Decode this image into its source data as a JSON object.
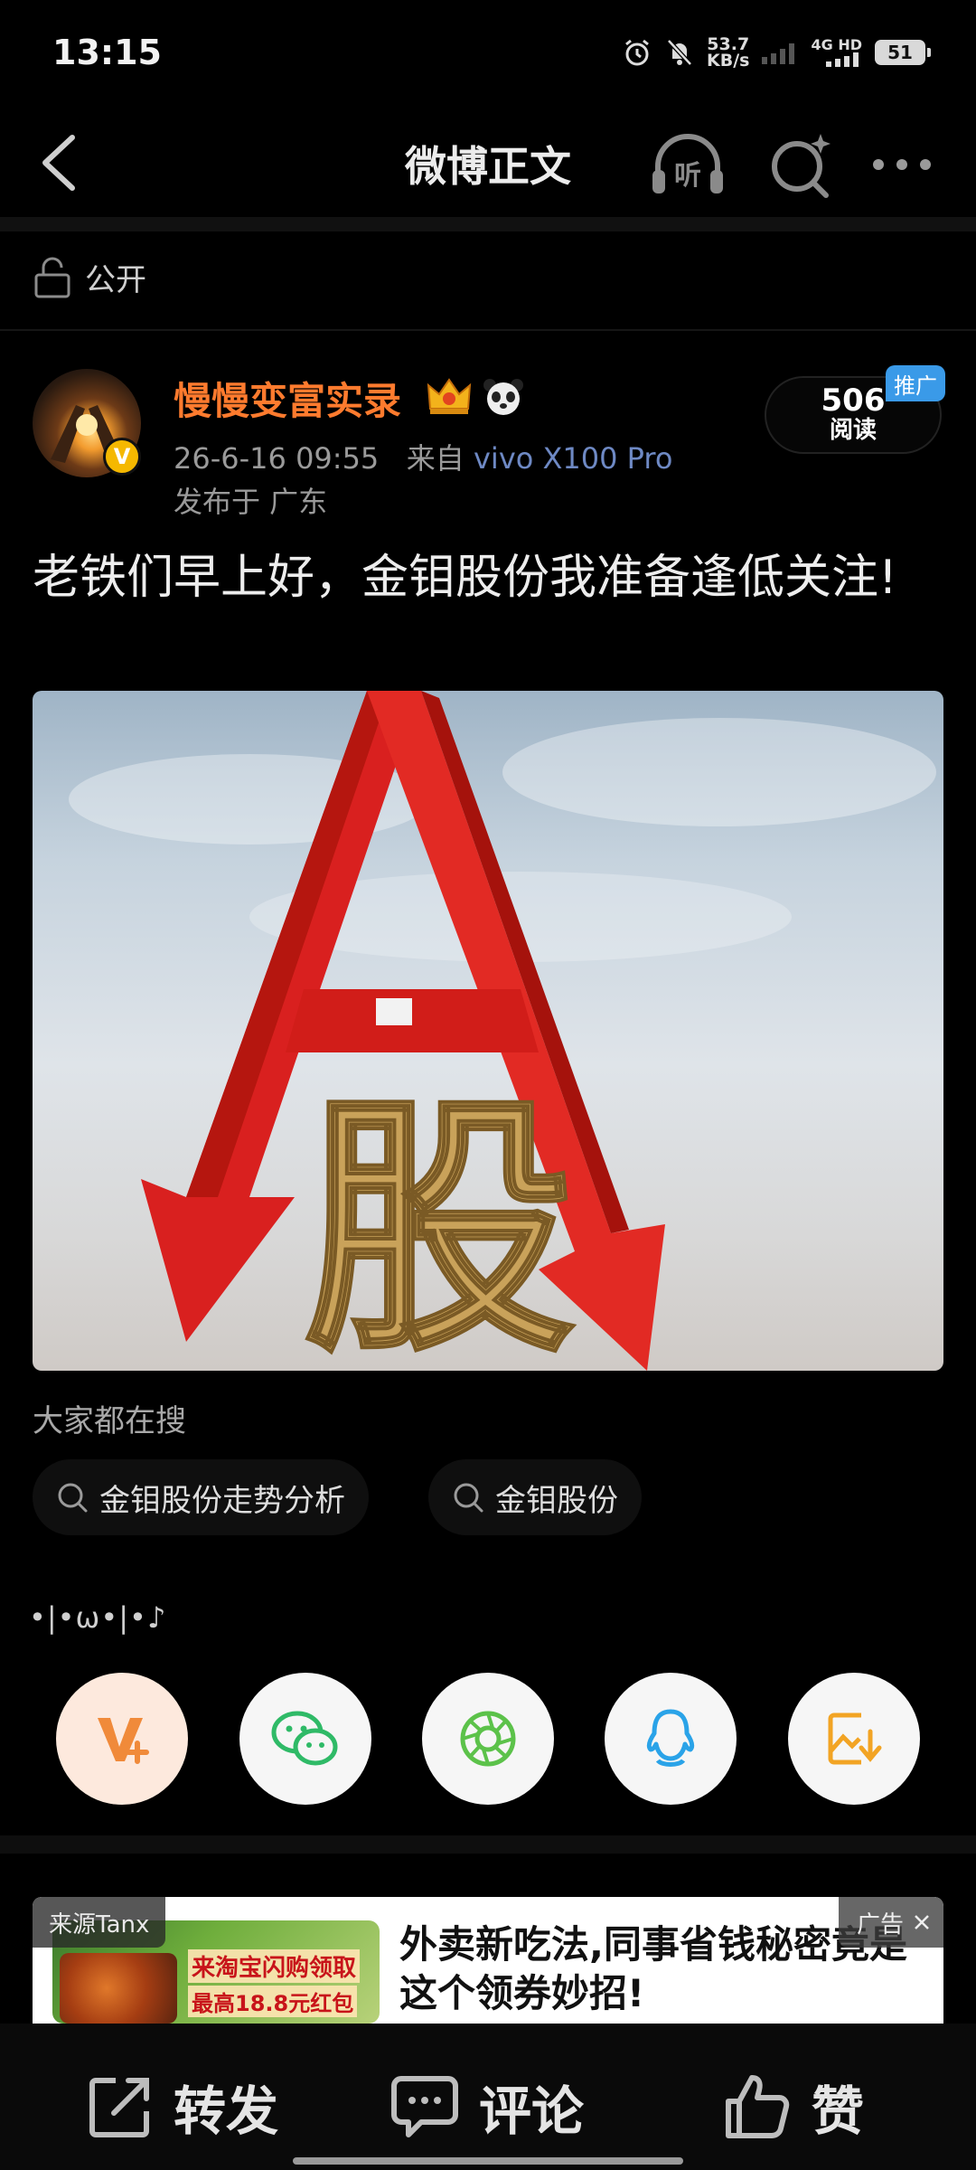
{
  "status_bar": {
    "time": "13:15",
    "net_speed_value": "53.7",
    "net_speed_unit": "KB/s",
    "network": "4G HD",
    "battery": "51"
  },
  "nav": {
    "title": "微博正文",
    "listen_label": "听"
  },
  "visibility": {
    "label": "公开"
  },
  "author": {
    "name": "慢慢变富实录",
    "verified_badge": "V",
    "timestamp": "26-6-16 09:55",
    "source_prefix": "来自",
    "device": "vivo X100 Pro",
    "location": "发布于 广东"
  },
  "read_stats": {
    "count": "506",
    "label": "阅读",
    "promo": "推广"
  },
  "post": {
    "text": "老铁们早上好，金钼股份我准备逢低关注!",
    "image_glyph": "股"
  },
  "search": {
    "heading": "大家都在搜",
    "suggestions": [
      "金钼股份走势分析",
      "金钼股份"
    ]
  },
  "kaomoji": "•|•ω•|•♪",
  "share_targets": [
    "vplus-icon",
    "wechat-icon",
    "moments-icon",
    "qq-icon",
    "save-image-icon"
  ],
  "ad": {
    "source": "来源Tanx",
    "badge": "广告",
    "image_line1": "来淘宝闪购领取",
    "image_line2": "最高18.8元红包",
    "headline": "外卖新吃法,同事省钱秘密竟是这个领券妙招!"
  },
  "bottom_bar": {
    "repost": "转发",
    "comment": "评论",
    "like": "赞"
  },
  "colors": {
    "author_name": "#ff7b2e",
    "device_link": "#6e89c4",
    "promo": "#3a9ae8"
  }
}
